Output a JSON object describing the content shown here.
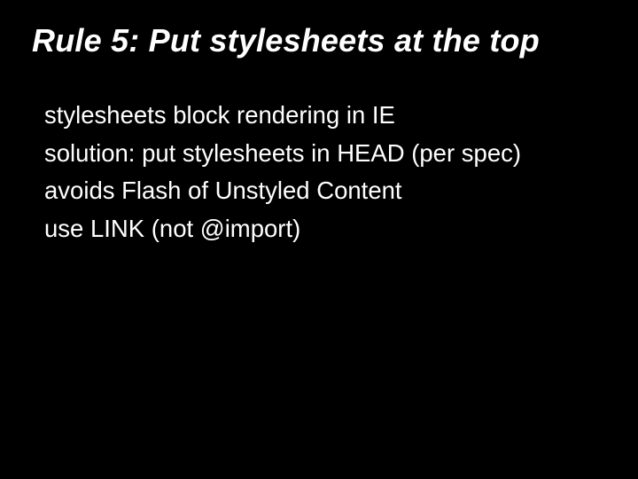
{
  "slide": {
    "title": "Rule 5: Put stylesheets at the top",
    "lines": [
      "stylesheets block rendering in IE",
      "solution: put stylesheets in HEAD (per spec)",
      "avoids Flash of Unstyled Content",
      "use LINK (not @import)"
    ]
  }
}
